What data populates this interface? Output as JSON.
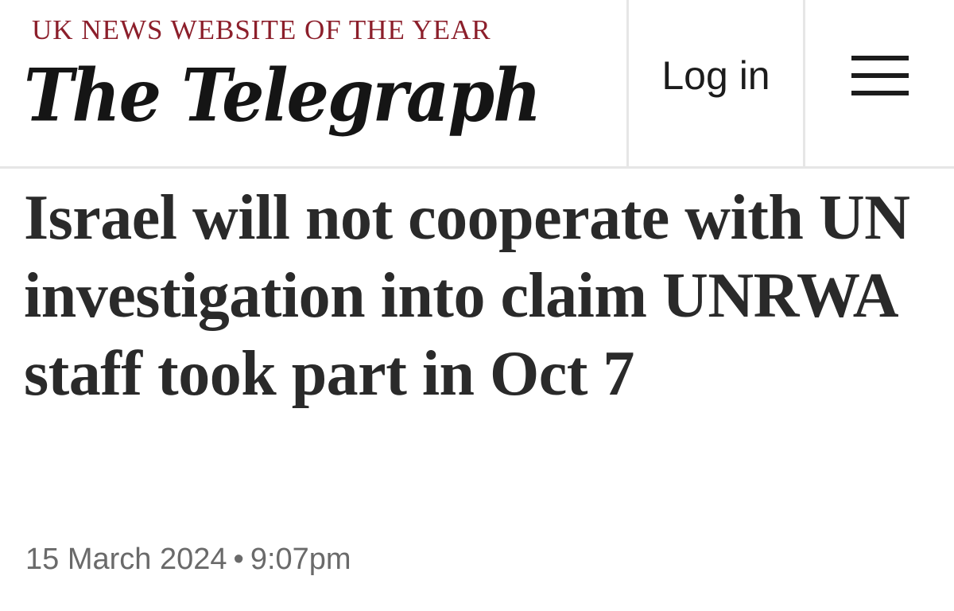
{
  "header": {
    "tagline": "UK NEWS WEBSITE OF THE YEAR",
    "logo_text": "The Telegraph",
    "login_label": "Log in",
    "menu_icon": "hamburger-menu-icon"
  },
  "article": {
    "headline": "Israel will not cooperate with UN investigation into claim UNRWA staff took part in Oct 7",
    "date": "15 March 2024",
    "separator": "•",
    "time": "9:07pm"
  },
  "colors": {
    "tagline": "#8c1f2b",
    "text": "#2a2a2a",
    "meta": "#6a6a6a",
    "divider": "#e6e6e6"
  }
}
